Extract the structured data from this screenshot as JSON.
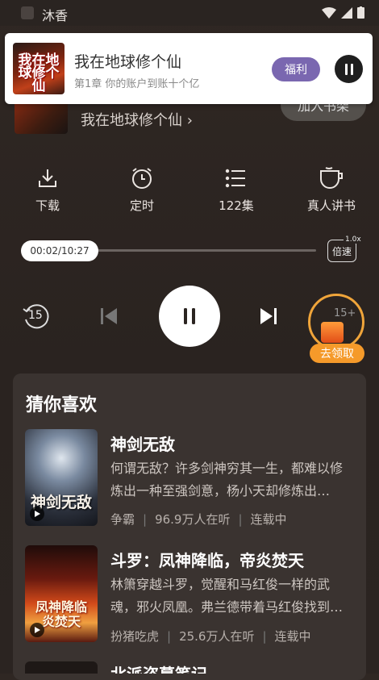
{
  "status": {
    "app_name": "沐香"
  },
  "notification": {
    "cover_text": "我在地球修个仙",
    "title": "我在地球修个仙",
    "subtitle": "第1章 你的账户到账十个亿",
    "welfare_label": "福利"
  },
  "header": {
    "book_title": "我在地球修个仙 ›",
    "add_shelf_label": "加入书架"
  },
  "toolbar": [
    {
      "label": "下载",
      "icon": "download-icon"
    },
    {
      "label": "定时",
      "icon": "alarm-icon"
    },
    {
      "label": "122集",
      "icon": "list-icon"
    },
    {
      "label": "真人讲书",
      "icon": "cup-icon"
    }
  ],
  "player": {
    "time": "00:02/10:27",
    "progress": 0.003,
    "speed_label": "倍速",
    "speed_value": "1.0x",
    "rewind_label": "15",
    "forward_label": "15+",
    "reward_label": "去领取"
  },
  "recommend": {
    "title": "猜你喜欢",
    "items": [
      {
        "title": "神剑无敌",
        "desc": "何谓无敌？许多剑神穷其一生，都难以修炼出一种至强剑意，杨小天却修炼出…",
        "author": "争霸",
        "listeners": "96.9万人在听",
        "status": "连载中",
        "cover_text": "神剑无敌"
      },
      {
        "title": "斗罗：凤神降临，帝炎焚天",
        "desc": "林箫穿越斗罗，觉醒和马红俊一样的武魂，邪火凤凰。弗兰德带着马红俊找到…",
        "author": "扮猪吃虎",
        "listeners": "25.6万人在听",
        "status": "连载中",
        "cover_text": "凤神降临 炎焚天"
      },
      {
        "title": "北派盗墓笔记"
      }
    ]
  },
  "colors": {
    "accent_purple": "#7a67b0",
    "reward_orange": "#f59a2a",
    "background": "#2b2421"
  }
}
